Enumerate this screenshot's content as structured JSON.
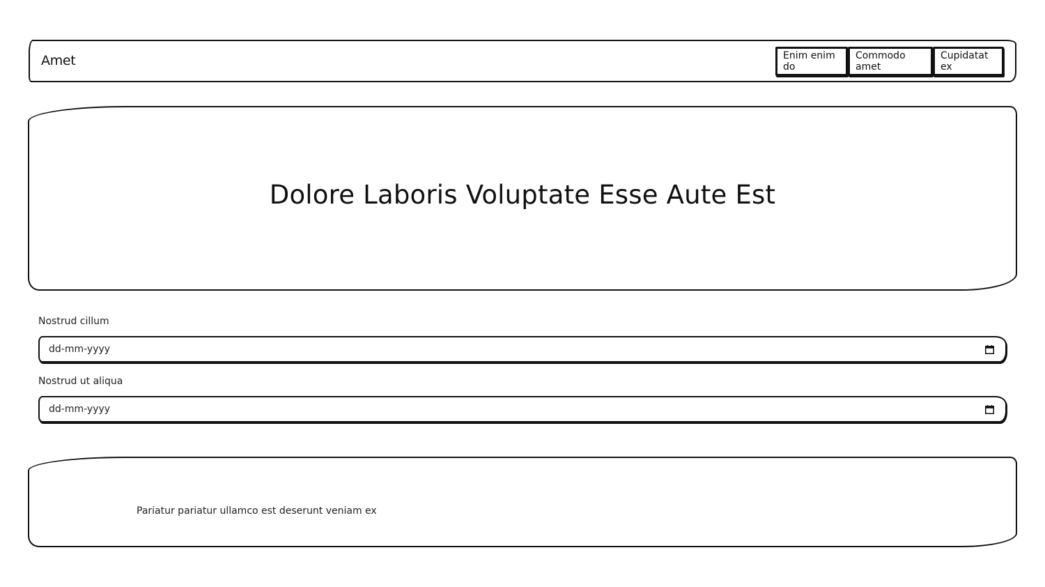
{
  "header": {
    "brand": "Amet",
    "nav": [
      {
        "label": "Enim enim do"
      },
      {
        "label": "Commodo amet"
      },
      {
        "label": "Cupidatat ex"
      }
    ]
  },
  "hero": {
    "title": "Dolore Laboris Voluptate Esse Aute Est"
  },
  "form": {
    "fields": [
      {
        "label": "Nostrud cillum",
        "placeholder": "dd-mm-yyyy",
        "icon": "calendar-icon"
      },
      {
        "label": "Nostrud ut aliqua",
        "placeholder": "dd-mm-yyyy",
        "icon": "calendar-icon"
      }
    ]
  },
  "footer": {
    "text": "Pariatur pariatur ullamco est deserunt veniam ex"
  }
}
